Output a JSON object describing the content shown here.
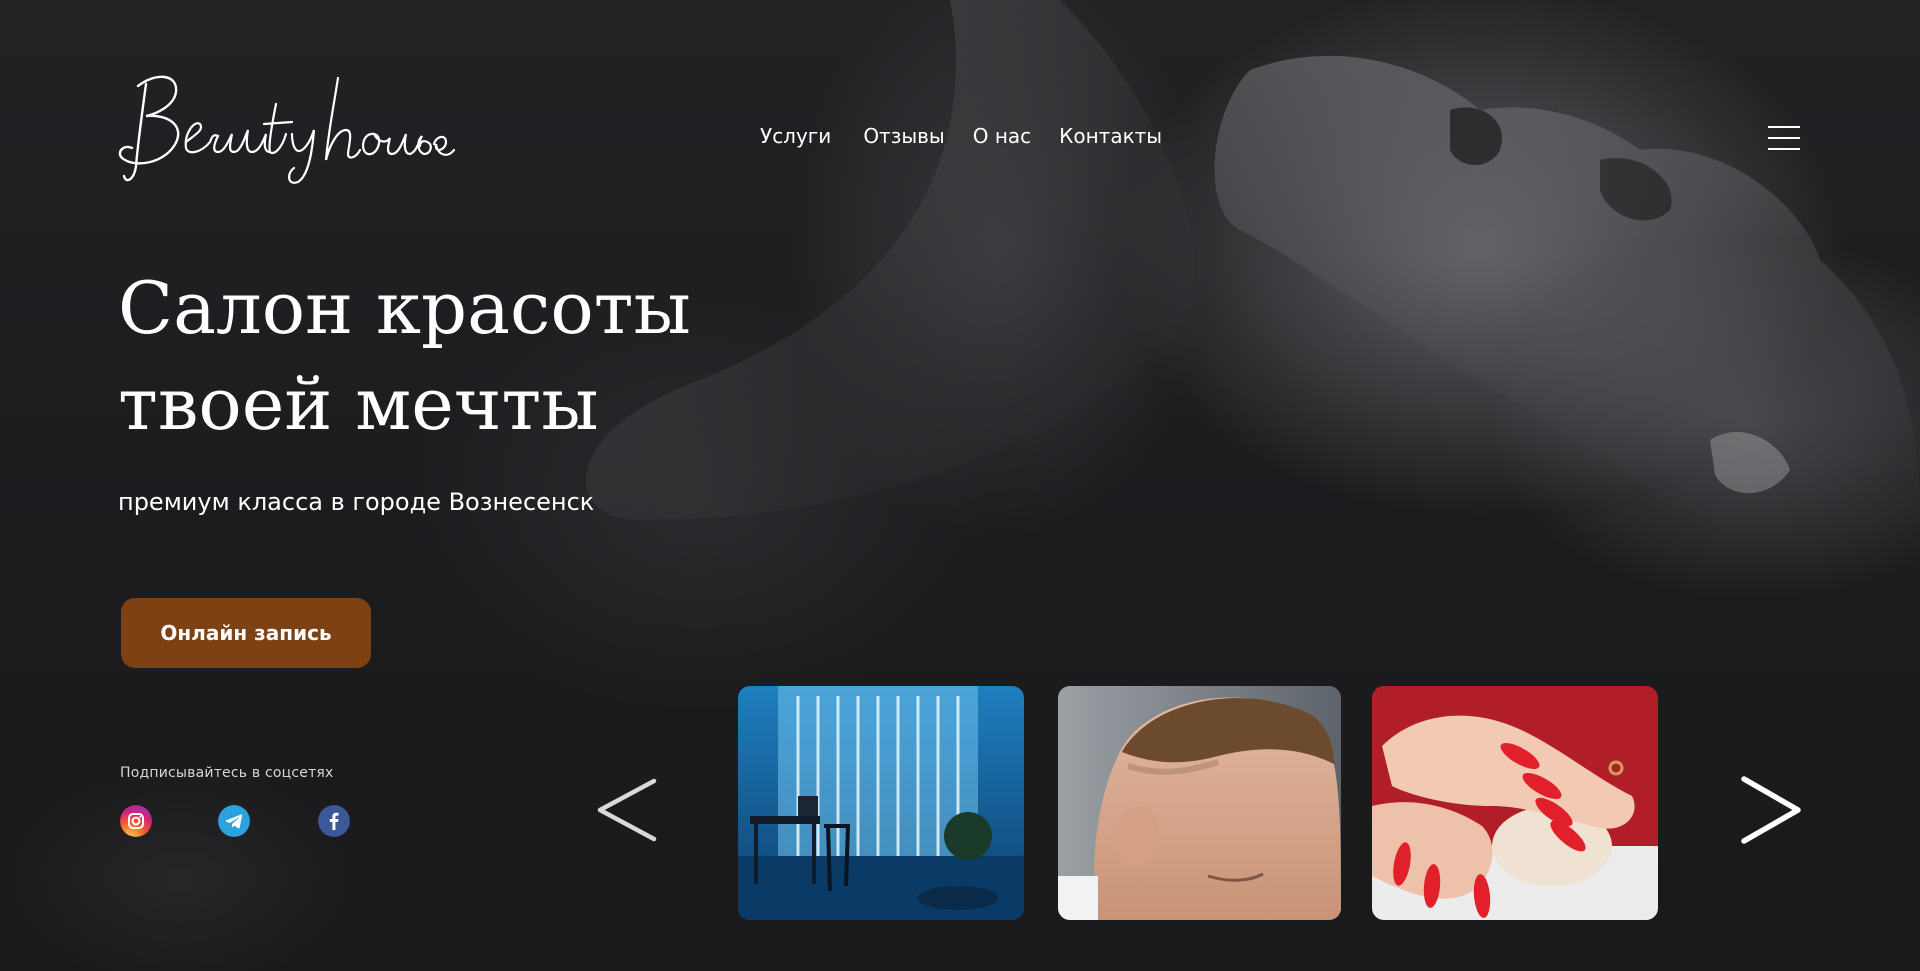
{
  "brand": {
    "logo_text": "Beauty house"
  },
  "nav": {
    "items": [
      {
        "label": "Услуги"
      },
      {
        "label": "Отзывы"
      },
      {
        "label": "О нас"
      },
      {
        "label": "Контакты"
      }
    ],
    "menu_icon": "hamburger-menu-icon"
  },
  "hero": {
    "title_line1": "Салон красоты",
    "title_line2": "твоей мечты",
    "subtitle": "премиум класса в городе Вознесенск",
    "cta_label": "Онлайн запись",
    "cta_color": "#7d4113"
  },
  "social": {
    "label": "Подписывайтесь в соцсетях",
    "icons": [
      "instagram-icon",
      "telegram-icon",
      "facebook-icon"
    ]
  },
  "carousel": {
    "prev_icon": "chevron-left-icon",
    "next_icon": "chevron-right-icon",
    "slides": [
      {
        "subject": "salon-interior-photo"
      },
      {
        "subject": "haircut-photo"
      },
      {
        "subject": "manicure-photo"
      }
    ]
  }
}
